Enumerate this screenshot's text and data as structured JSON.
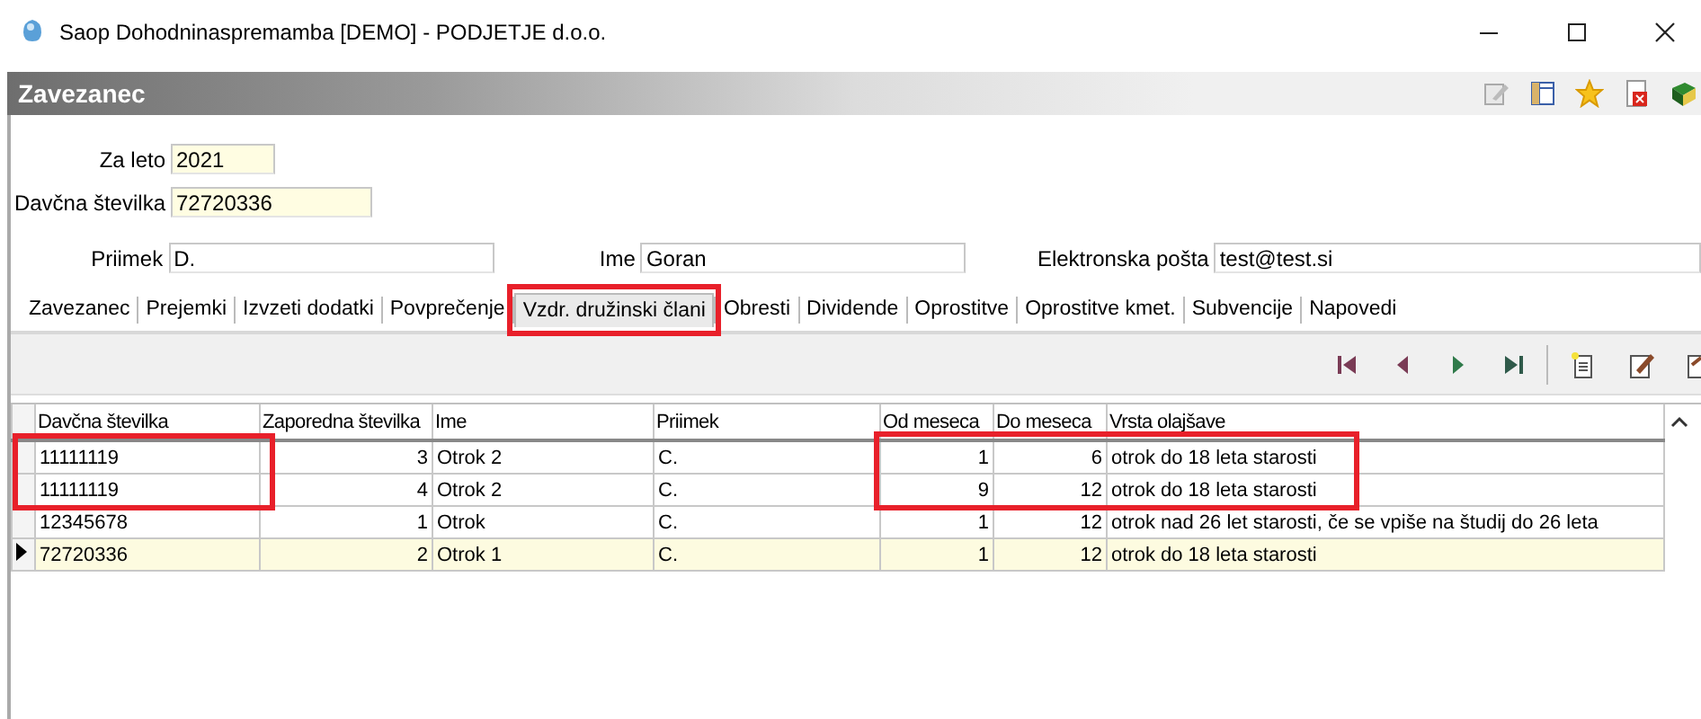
{
  "window": {
    "title": "Saop Dohodninaspremamba [DEMO] - PODJETJE d.o.o."
  },
  "panel": {
    "title": "Zavezanec"
  },
  "form": {
    "fields": [
      {
        "label": "Za leto",
        "value": "2021",
        "kind": "required"
      },
      {
        "label": "Davčna številka",
        "value": "72720336",
        "kind": "required"
      },
      {
        "label": "Priimek",
        "value": "D.",
        "kind": "plain"
      },
      {
        "label": "Ime",
        "value": "Goran",
        "kind": "plain"
      },
      {
        "label": "Elektronska pošta",
        "value": "test@test.si",
        "kind": "plain"
      }
    ]
  },
  "tabs": [
    {
      "label": "Zavezanec",
      "selected": false
    },
    {
      "label": "Prejemki",
      "selected": false
    },
    {
      "label": "Izvzeti dodatki",
      "selected": false
    },
    {
      "label": "Povprečenje",
      "selected": false
    },
    {
      "label": "Vzdr. družinski člani",
      "selected": true
    },
    {
      "label": "Obresti",
      "selected": false
    },
    {
      "label": "Dividende",
      "selected": false
    },
    {
      "label": "Oprostitve",
      "selected": false
    },
    {
      "label": "Oprostitve kmet.",
      "selected": false
    },
    {
      "label": "Subvencije",
      "selected": false
    },
    {
      "label": "Napovedi",
      "selected": false
    }
  ],
  "table": {
    "columns": [
      "Davčna številka",
      "Zaporedna številka",
      "Ime",
      "Priimek",
      "Od meseca",
      "Do meseca",
      "Vrsta olajšave"
    ],
    "rows": [
      {
        "cells": [
          "11111119",
          "3",
          "Otrok 2",
          "C.",
          "1",
          "6",
          "otrok do 18 leta starosti"
        ],
        "selected": false
      },
      {
        "cells": [
          "11111119",
          "4",
          "Otrok 2",
          "C.",
          "9",
          "12",
          "otrok do 18 leta starosti"
        ],
        "selected": false
      },
      {
        "cells": [
          "12345678",
          "1",
          "Otrok",
          "C.",
          "1",
          "12",
          "otrok nad 26 let starosti, če se vpiše na študij do 26 leta"
        ],
        "selected": false
      },
      {
        "cells": [
          "72720336",
          "2",
          "Otrok 1",
          "C.",
          "1",
          "12",
          "otrok do 18 leta starosti"
        ],
        "selected": true
      }
    ]
  }
}
